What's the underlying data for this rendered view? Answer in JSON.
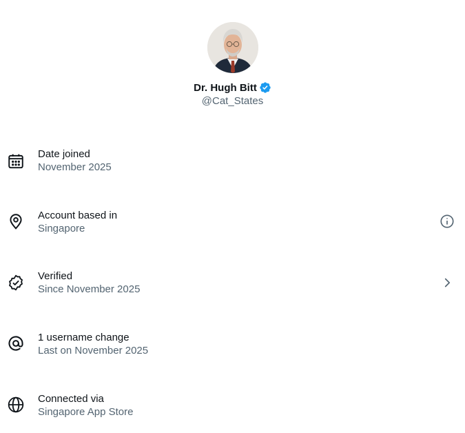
{
  "profile": {
    "display_name": "Dr. Hugh Bitt",
    "handle": "@Cat_States",
    "verified_color": "#1d9bf0"
  },
  "rows": [
    {
      "icon": "calendar-icon",
      "label": "Date joined",
      "sub": "November 2025"
    },
    {
      "icon": "location-pin-icon",
      "label": "Account based in",
      "sub": "Singapore",
      "action_icon": "info-icon"
    },
    {
      "icon": "verified-seal-icon",
      "label": "Verified",
      "sub": "Since November 2025",
      "action_icon": "chevron-right-icon"
    },
    {
      "icon": "at-sign-icon",
      "label": "1 username change",
      "sub": "Last on November 2025"
    },
    {
      "icon": "globe-icon",
      "label": "Connected via",
      "sub": "Singapore App Store"
    }
  ],
  "colors": {
    "primary_text": "#0f1419",
    "secondary_text": "#536471",
    "accent": "#1d9bf0"
  }
}
